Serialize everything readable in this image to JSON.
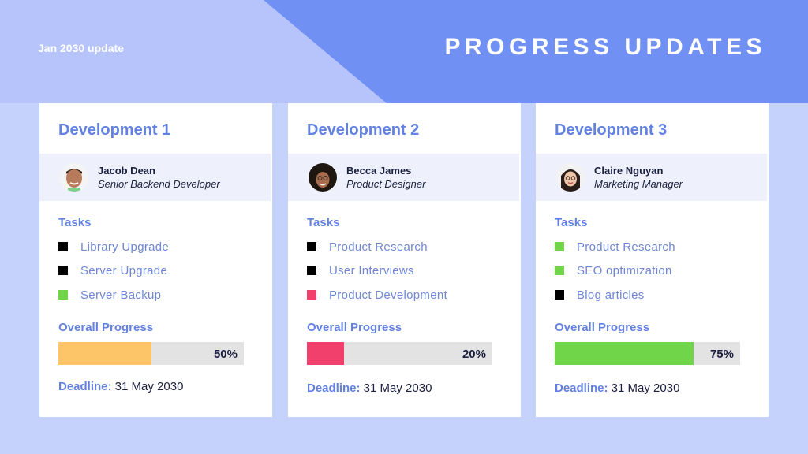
{
  "header": {
    "subtitle": "Jan 2030 update",
    "title": "PROGRESS UPDATES"
  },
  "colors": {
    "accent": "#6381e0",
    "header_dark": "#7090f3",
    "header_light": "#b6c4fb",
    "background": "#c5d2fb",
    "status_done": "#71d54a",
    "status_todo": "#000000",
    "status_blocked": "#f2406c",
    "progress_orange": "#fdc468",
    "progress_pink": "#f2406c",
    "progress_green": "#71d54a",
    "progress_track": "#e3e3e3"
  },
  "cards": [
    {
      "title": "Development 1",
      "person": {
        "name": "Jacob Dean",
        "role": "Senior Backend Developer",
        "avatar": "avatar-man-icon"
      },
      "tasks_label": "Tasks",
      "tasks": [
        {
          "label": "Library Upgrade",
          "status_color": "#000000"
        },
        {
          "label": "Server Upgrade",
          "status_color": "#000000"
        },
        {
          "label": "Server Backup",
          "status_color": "#71d54a"
        }
      ],
      "progress_label": "Overall Progress",
      "progress_percent": 50,
      "progress_text": "50%",
      "progress_color": "#fdc468",
      "deadline_label": "Deadline:",
      "deadline_value": " 31 May 2030"
    },
    {
      "title": "Development 2",
      "person": {
        "name": "Becca James",
        "role": "Product Designer",
        "avatar": "avatar-woman-curly-icon"
      },
      "tasks_label": "Tasks",
      "tasks": [
        {
          "label": "Product Research",
          "status_color": "#000000"
        },
        {
          "label": "User Interviews",
          "status_color": "#000000"
        },
        {
          "label": "Product Development",
          "status_color": "#f2406c"
        }
      ],
      "progress_label": "Overall Progress",
      "progress_percent": 20,
      "progress_text": "20%",
      "progress_color": "#f2406c",
      "deadline_label": "Deadline:",
      "deadline_value": " 31 May 2030"
    },
    {
      "title": "Development 3",
      "person": {
        "name": "Claire Nguyan",
        "role": "Marketing Manager",
        "avatar": "avatar-woman-icon"
      },
      "tasks_label": "Tasks",
      "tasks": [
        {
          "label": "Product Research",
          "status_color": "#71d54a"
        },
        {
          "label": "SEO optimization",
          "status_color": "#71d54a"
        },
        {
          "label": "Blog articles",
          "status_color": "#000000"
        }
      ],
      "progress_label": "Overall Progress",
      "progress_percent": 75,
      "progress_text": "75%",
      "progress_color": "#71d54a",
      "deadline_label": "Deadline:",
      "deadline_value": " 31 May 2030"
    }
  ]
}
